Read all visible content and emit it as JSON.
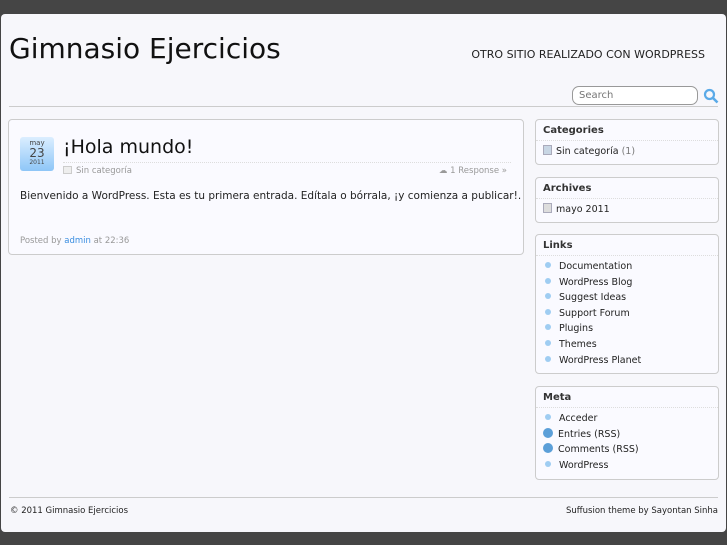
{
  "site": {
    "title": "Gimnasio Ejercicios",
    "tagline": "OTRO SITIO REALIZADO CON WORDPRESS"
  },
  "search": {
    "placeholder": "Search"
  },
  "post": {
    "month": "may",
    "day": "23",
    "year": "2011",
    "title": "¡Hola mundo!",
    "category": "Sin categoría",
    "responses": "1 Response »",
    "body": "Bienvenido a WordPress. Esta es tu primera entrada. Edítala o bórrala, ¡y comienza a publicar!.",
    "posted_by": "Posted by",
    "author": "admin",
    "at": "at 22:36"
  },
  "sidebar": {
    "categories": {
      "title": "Categories",
      "item": "Sin categoría",
      "count": "(1)"
    },
    "archives": {
      "title": "Archives",
      "item": "mayo 2011"
    },
    "links": {
      "title": "Links",
      "items": [
        "Documentation",
        "WordPress Blog",
        "Suggest Ideas",
        "Support Forum",
        "Plugins",
        "Themes",
        "WordPress Planet"
      ]
    },
    "meta": {
      "title": "Meta",
      "items": [
        "Acceder",
        "Entries (RSS)",
        "Comments (RSS)",
        "WordPress"
      ]
    }
  },
  "footer": {
    "copyright": "© 2011 Gimnasio Ejercicios",
    "credit": "Suffusion theme by Sayontan Sinha"
  }
}
